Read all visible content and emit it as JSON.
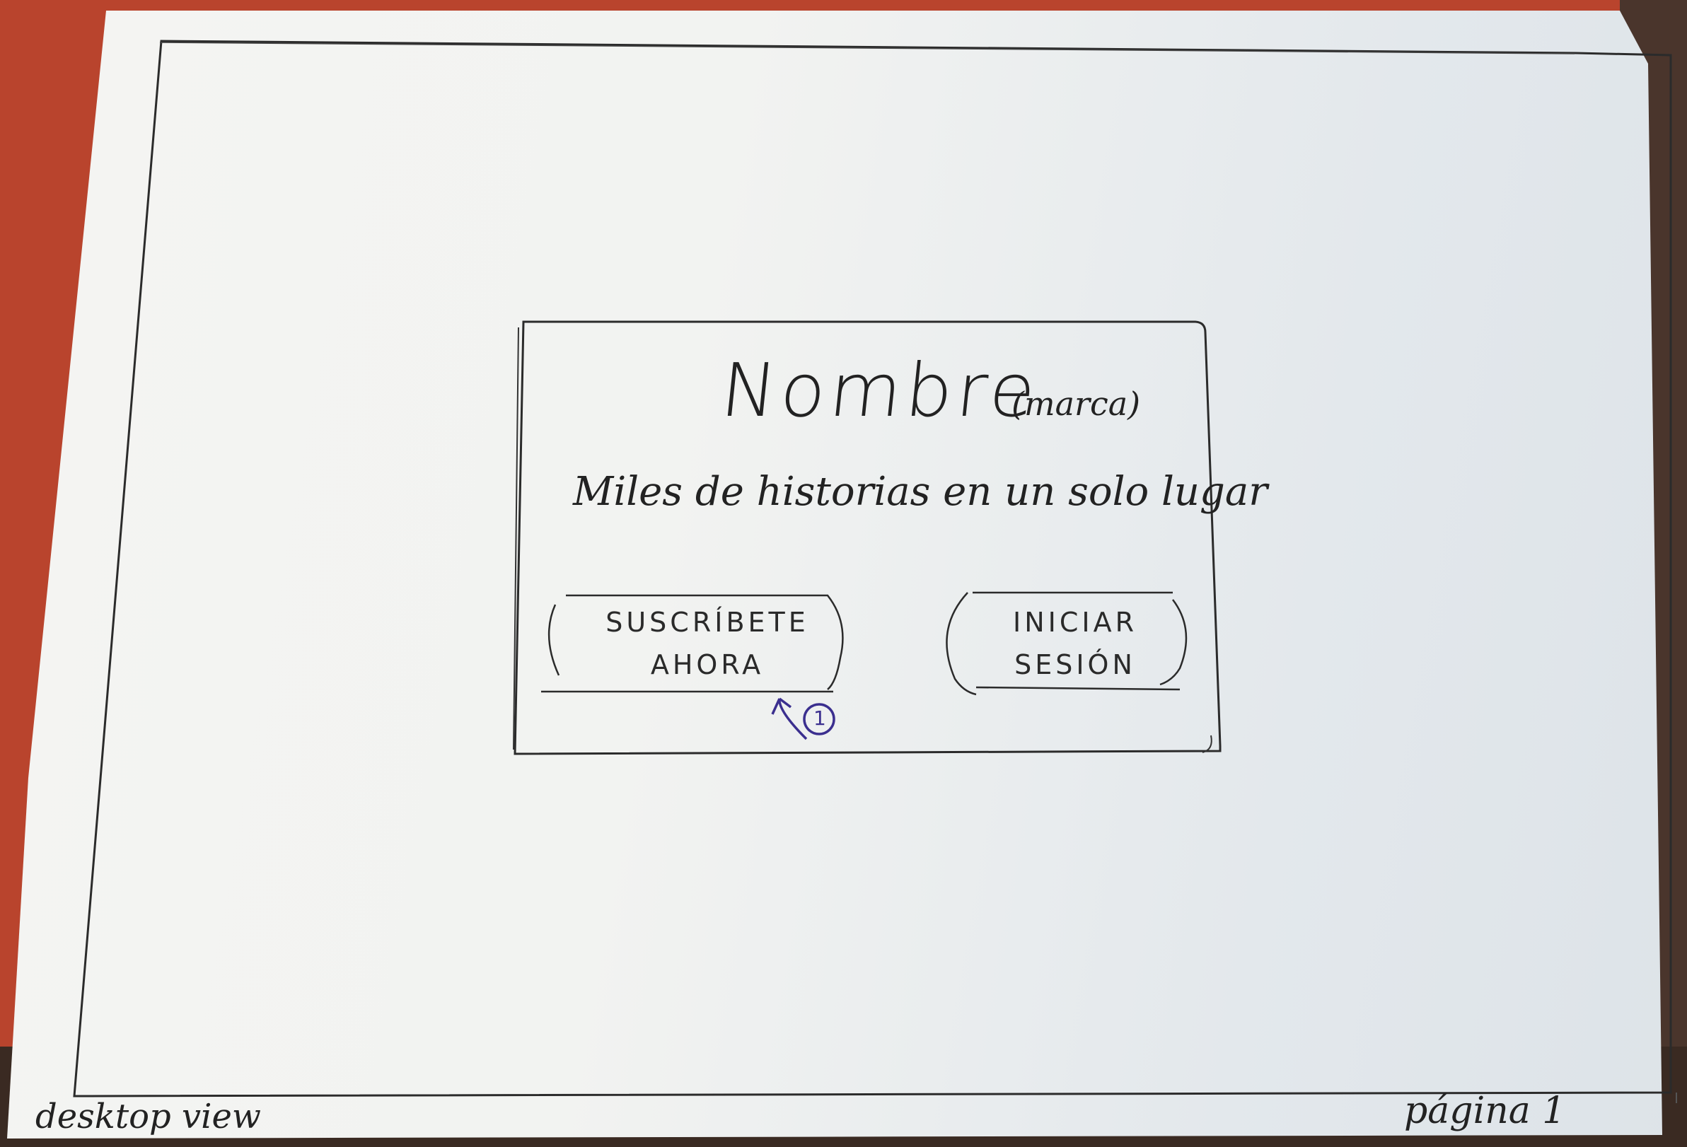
{
  "sketch": {
    "brand": "Nombre",
    "brand_note": "(marca)",
    "tagline": "Miles de historias en un solo lugar",
    "buttons": {
      "subscribe_line1": "SUSCRÍBETE",
      "subscribe_line2": "AHORA",
      "login_line1": "INICIAR",
      "login_line2": "SESIÓN"
    },
    "annotation": "1"
  },
  "footer": {
    "view_label": "desktop view",
    "page_label": "página 1"
  },
  "colors": {
    "ink": "#222222",
    "annotation_ink": "#3b2f8f",
    "paper": "#f2f3f1",
    "background": "#b9442d"
  }
}
